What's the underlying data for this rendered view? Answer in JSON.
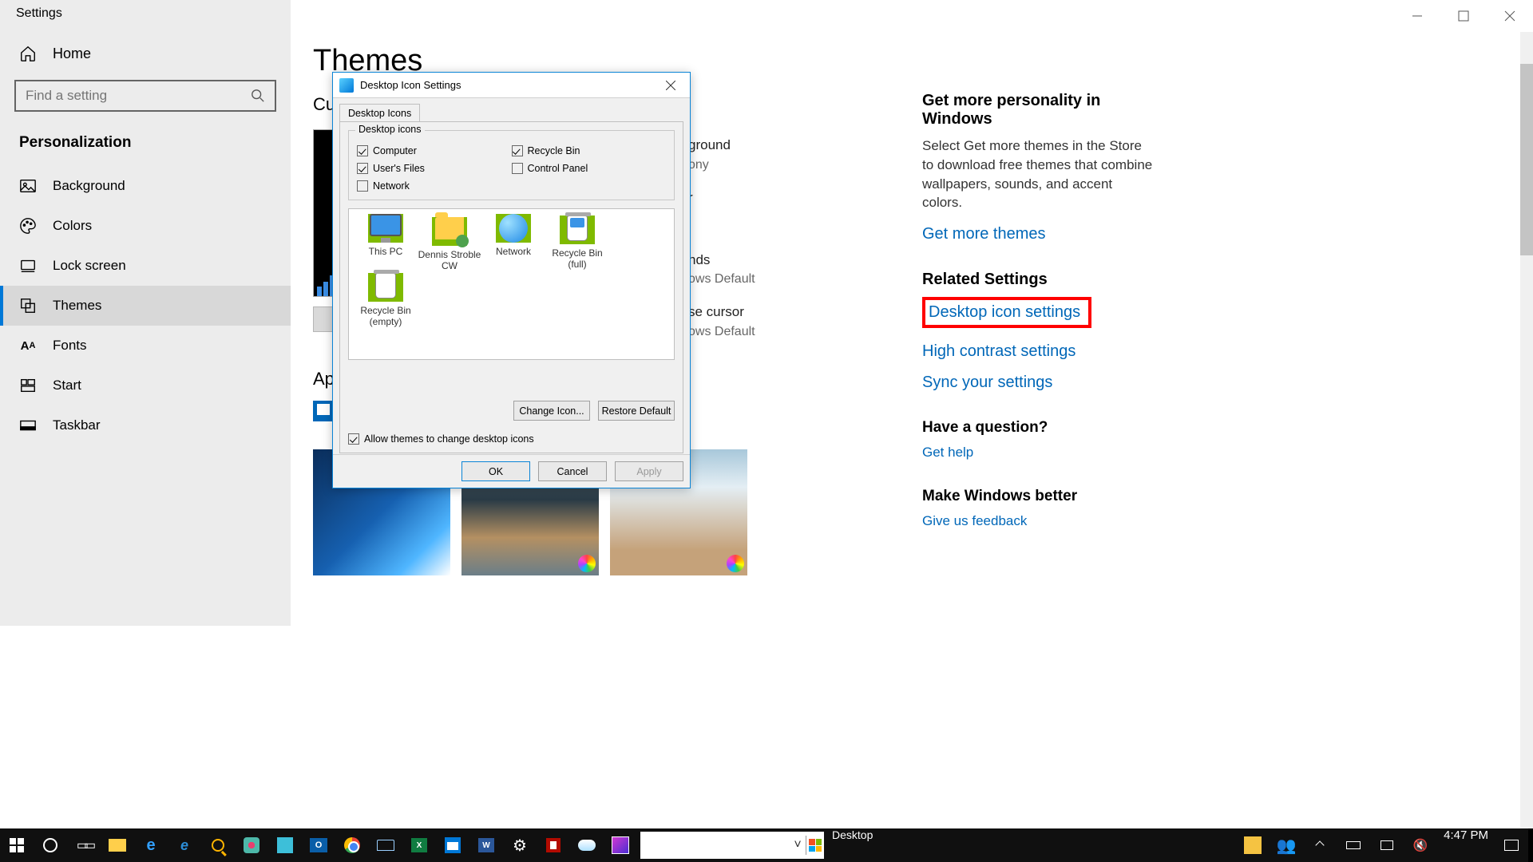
{
  "window": {
    "title": "Settings"
  },
  "sidebar": {
    "home": "Home",
    "search_placeholder": "Find a setting",
    "category": "Personalization",
    "items": [
      {
        "label": "Background"
      },
      {
        "label": "Colors"
      },
      {
        "label": "Lock screen"
      },
      {
        "label": "Themes"
      },
      {
        "label": "Fonts"
      },
      {
        "label": "Start"
      },
      {
        "label": "Taskbar"
      }
    ]
  },
  "main": {
    "page_title": "Themes",
    "current_theme": "Cu",
    "apply_theme": "Ap",
    "bg": {
      "l1": "ground",
      "v1": "ony",
      "l2": "r",
      "l3": "nds",
      "v3": "ows Default",
      "l4": "se cursor",
      "v4": "ows Default"
    }
  },
  "info": {
    "more_head": "Get more personality in Windows",
    "more_body": "Select Get more themes in the Store to download free themes that combine wallpapers, sounds, and accent colors.",
    "more_link": "Get more themes",
    "related_head": "Related Settings",
    "link_desktop": "Desktop icon settings",
    "link_contrast": "High contrast settings",
    "link_sync": "Sync your settings",
    "question_head": "Have a question?",
    "link_help": "Get help",
    "better_head": "Make Windows better",
    "link_feedback": "Give us feedback"
  },
  "dialog": {
    "title": "Desktop Icon Settings",
    "tab": "Desktop Icons",
    "group_legend": "Desktop icons",
    "chk_computer": "Computer",
    "chk_recycle": "Recycle Bin",
    "chk_user": "User's Files",
    "chk_control": "Control Panel",
    "chk_network": "Network",
    "icons": {
      "pc": "This PC",
      "user": "Dennis Stroble CW",
      "net": "Network",
      "bin_full": "Recycle Bin (full)",
      "bin_empty": "Recycle Bin (empty)"
    },
    "btn_change": "Change Icon...",
    "btn_restore": "Restore Default",
    "allow": "Allow themes to change desktop icons",
    "ok": "OK",
    "cancel": "Cancel",
    "apply": "Apply"
  },
  "taskbar": {
    "addr_label": "Desktop",
    "time": "4:47 PM"
  }
}
